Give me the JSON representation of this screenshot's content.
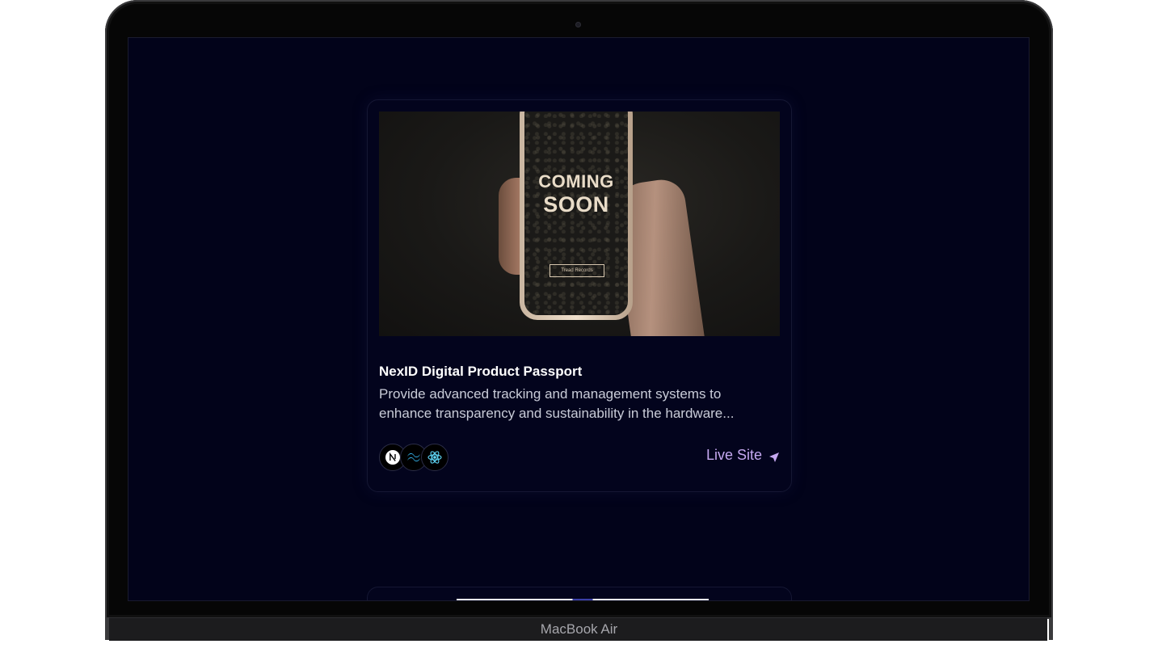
{
  "device": {
    "brand_label": "MacBook Air"
  },
  "project_card": {
    "image": {
      "screen_text_line1": "COMING",
      "screen_text_line2": "SOON",
      "screen_button_text": "Tread Records"
    },
    "title": "NexID Digital Product Passport",
    "description_line1": "Provide advanced tracking and management systems to",
    "description_line2": "enhance transparency and sustainability in the hardware...",
    "tech_stack": [
      {
        "icon": "nextjs-icon",
        "glyph": "N"
      },
      {
        "icon": "tailwind-icon"
      },
      {
        "icon": "react-icon"
      }
    ],
    "live_site_label": "Live Site",
    "accent_color": "#c5a8f0"
  },
  "colors": {
    "screen_background": "#02031a",
    "card_border": "#151733"
  }
}
